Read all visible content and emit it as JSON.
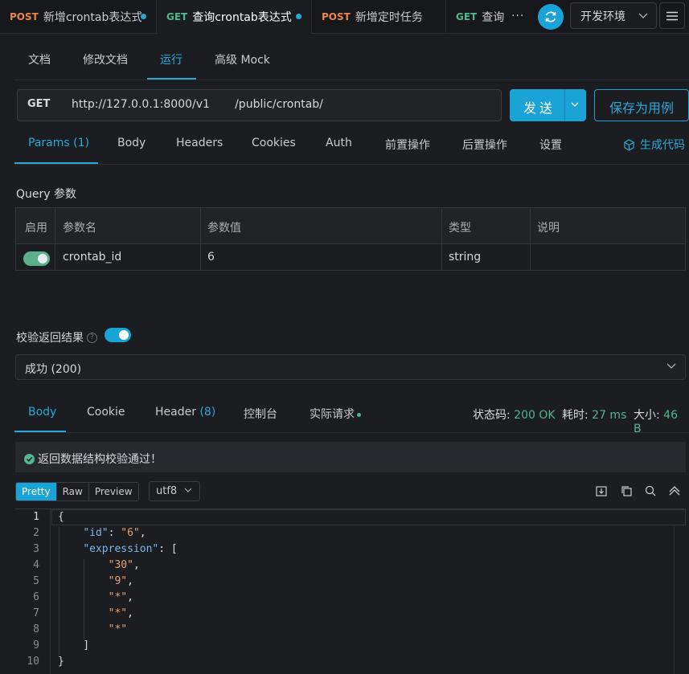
{
  "tabs": [
    {
      "method": "POST",
      "title": "新增crontab表达式",
      "unsaved": true
    },
    {
      "method": "GET",
      "title": "查询crontab表达式",
      "unsaved": true,
      "active": true
    },
    {
      "method": "POST",
      "title": "新增定时任务",
      "unsaved": false
    },
    {
      "method": "GET",
      "title": "查询",
      "unsaved": false
    }
  ],
  "tabs_more": "···",
  "env": {
    "label": "开发环境"
  },
  "subnav": [
    "文档",
    "修改文档",
    "运行",
    "高级 Mock"
  ],
  "subnav_active": "运行",
  "request": {
    "method": "GET",
    "url": "http://127.0.0.1:8000/v1       /public/crontab/",
    "send_label": "发送",
    "save_label": "保存为用例"
  },
  "param_tabs": [
    "Params (1)",
    "Body",
    "Headers",
    "Cookies",
    "Auth",
    "前置操作",
    "后置操作",
    "设置"
  ],
  "gen_code_label": "生成代码",
  "query_title": "Query 参数",
  "params_table": {
    "headers": [
      "启用",
      "参数名",
      "参数值",
      "类型",
      "说明"
    ],
    "rows": [
      {
        "enabled": true,
        "name": "crontab_id",
        "value": "6",
        "type": "string",
        "desc": ""
      }
    ]
  },
  "verify_label": "校验返回结果",
  "verify_enabled": true,
  "status_select": "成功 (200)",
  "response_tabs": {
    "body": "Body",
    "cookie": "Cookie",
    "header": "Header",
    "header_count": "(8)",
    "console": "控制台",
    "actual": "实际请求"
  },
  "response_stats": {
    "status_label": "状态码:",
    "status_value": "200 OK",
    "time_label": "耗时:",
    "time_value": "27 ms",
    "size_label": "大小:",
    "size_value": "46 B"
  },
  "validation_msg": "返回数据结构校验通过！",
  "formats": [
    "Pretty",
    "Raw",
    "Preview"
  ],
  "format_active": "Pretty",
  "encoding": "utf8",
  "code_lines": [
    "1",
    "2",
    "3",
    "4",
    "5",
    "6",
    "7",
    "8",
    "9",
    "10"
  ],
  "json_body": {
    "id_key": "\"id\"",
    "id_val": "\"6\"",
    "expr_key": "\"expression\"",
    "items": [
      "\"30\"",
      "\"9\"",
      "\"*\"",
      "\"*\"",
      "\"*\""
    ]
  },
  "colors": {
    "accent": "#1aa3d6",
    "success": "#4fb88e",
    "post": "#e8854a"
  }
}
